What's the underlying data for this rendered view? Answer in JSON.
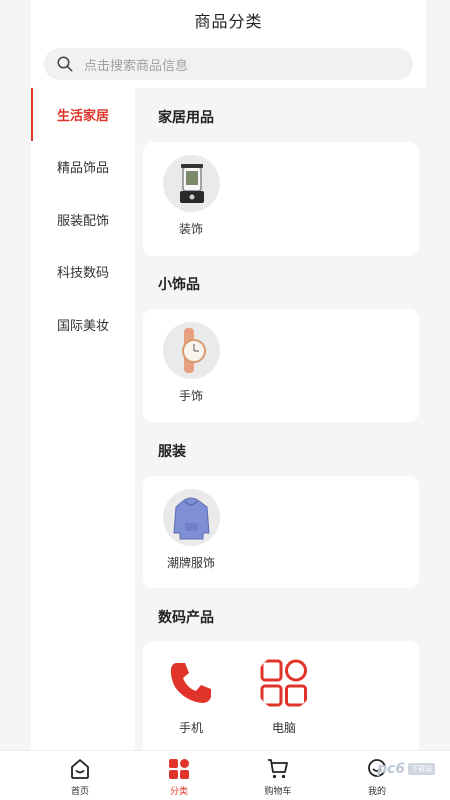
{
  "header": {
    "title": "商品分类"
  },
  "search": {
    "placeholder": "点击搜索商品信息"
  },
  "sidebar": {
    "items": [
      {
        "label": "生活家居",
        "active": true
      },
      {
        "label": "精品饰品",
        "active": false
      },
      {
        "label": "服装配饰",
        "active": false
      },
      {
        "label": "科技数码",
        "active": false
      },
      {
        "label": "国际美妆",
        "active": false
      }
    ]
  },
  "sections": [
    {
      "title": "家居用品",
      "items": [
        {
          "label": "装饰",
          "icon": "blender-image"
        }
      ]
    },
    {
      "title": "小饰品",
      "items": [
        {
          "label": "手饰",
          "icon": "watch-image"
        }
      ]
    },
    {
      "title": "服装",
      "items": [
        {
          "label": "潮牌服饰",
          "icon": "hoodie-image"
        }
      ]
    },
    {
      "title": "数码产品",
      "items": [
        {
          "label": "手机",
          "icon": "phone-icon"
        },
        {
          "label": "电脑",
          "icon": "grid-icon"
        }
      ]
    }
  ],
  "tabbar": {
    "tabs": [
      {
        "label": "首页",
        "icon": "home-icon",
        "active": false
      },
      {
        "label": "分类",
        "icon": "category-icon",
        "active": true
      },
      {
        "label": "购物车",
        "icon": "cart-icon",
        "active": false
      },
      {
        "label": "我的",
        "icon": "profile-icon",
        "active": false
      }
    ]
  },
  "watermark": {
    "text": "pc6",
    "badge": "下载站"
  },
  "colors": {
    "accent": "#e0342a",
    "background": "#f5f5f5",
    "card": "#ffffff"
  }
}
